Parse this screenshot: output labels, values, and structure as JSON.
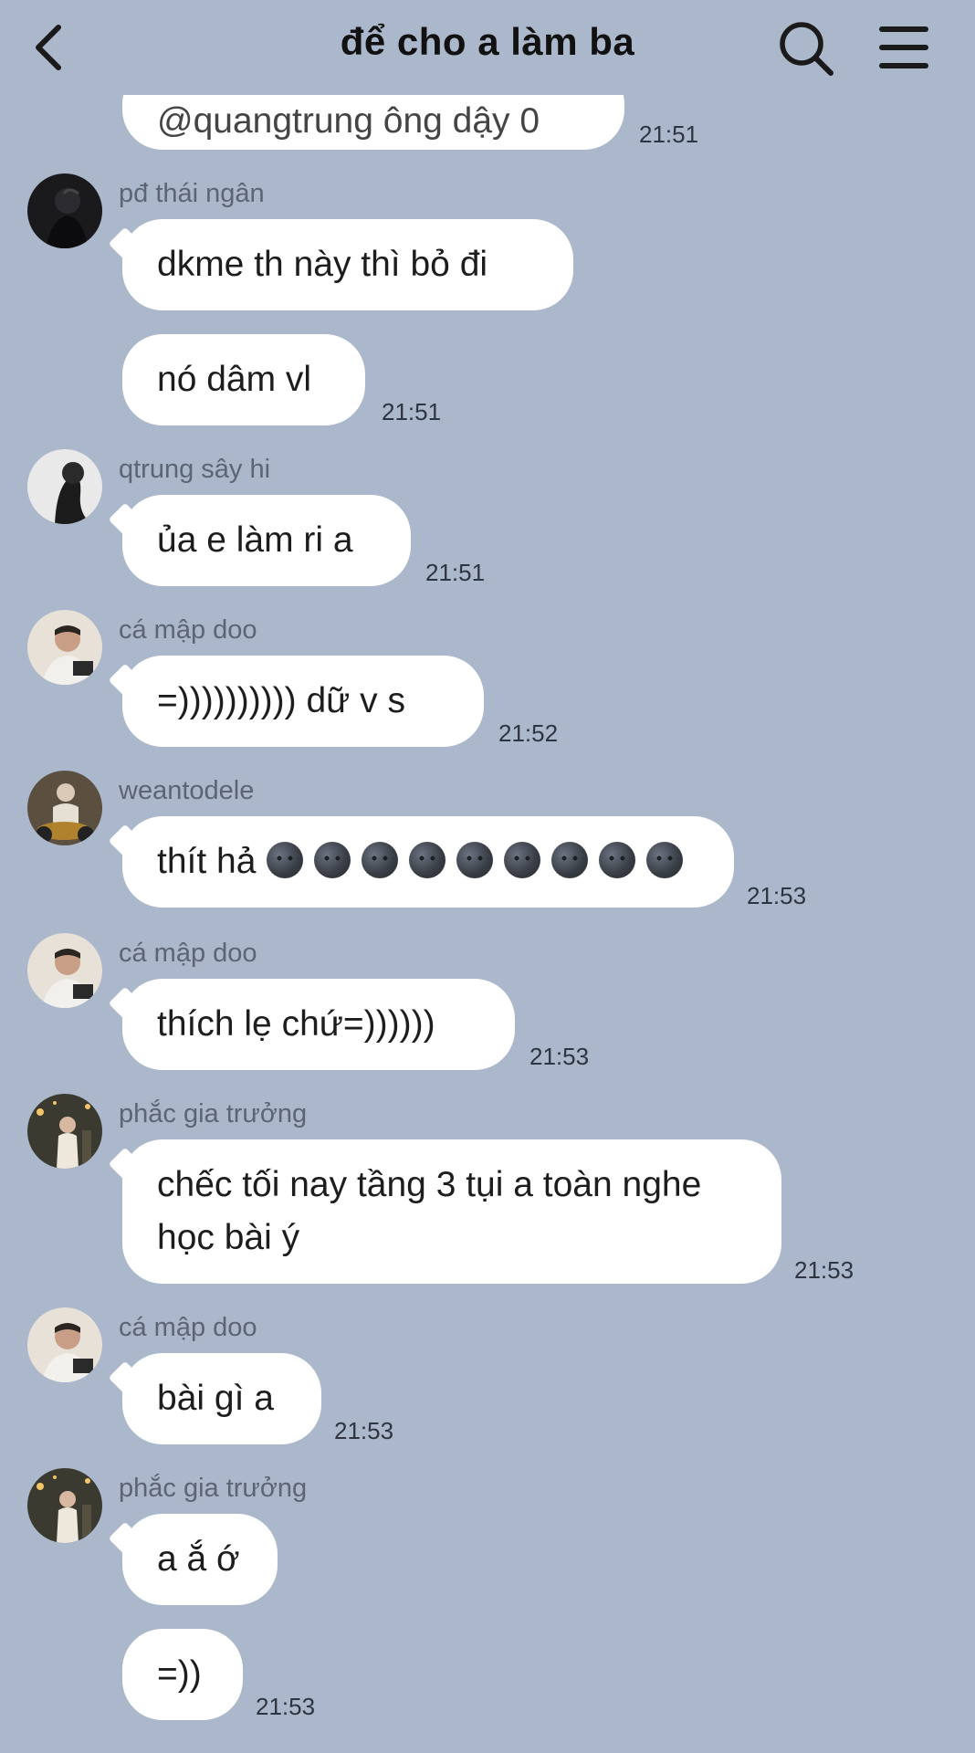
{
  "header": {
    "title": "để cho a làm ba",
    "back_icon": "chevron-left-icon",
    "search_icon": "search-icon",
    "menu_icon": "menu-icon"
  },
  "messages": [
    {
      "bubbles": [
        "@quangtrung ông dậy 0"
      ],
      "time": "21:51"
    },
    {
      "sender": "pđ thái ngân",
      "bubbles": [
        "dkme th này thì bỏ đi",
        "nó dâm vl"
      ],
      "time": "21:51"
    },
    {
      "sender": "qtrung sây hi",
      "bubbles": [
        "ủa e làm ri a"
      ],
      "time": "21:51"
    },
    {
      "sender": "cá mập doo",
      "bubbles": [
        "=)))))))))) dữ v s"
      ],
      "time": "21:52"
    },
    {
      "sender": "weantodele",
      "bubbles": [
        "thít hả"
      ],
      "emoji": "🌚",
      "emoji_count": 9,
      "time": "21:53"
    },
    {
      "sender": "cá mập doo",
      "bubbles": [
        "thích lẹ chứ=))))))"
      ],
      "time": "21:53"
    },
    {
      "sender": "phắc gia trưởng",
      "bubbles": [
        "chếc tối nay tầng 3 tụi a toàn nghe học bài ý"
      ],
      "time": "21:53"
    },
    {
      "sender": "cá mập doo",
      "bubbles": [
        "bài gì a"
      ],
      "time": "21:53"
    },
    {
      "sender": "phắc gia trưởng",
      "bubbles": [
        "a ắ ớ",
        "=))"
      ],
      "time": "21:53"
    }
  ]
}
